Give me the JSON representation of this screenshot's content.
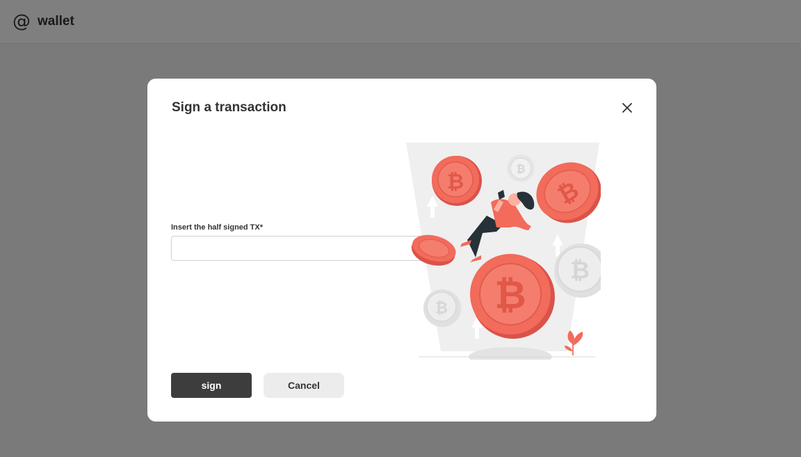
{
  "app": {
    "logo_symbol": "@",
    "logo_text": "wallet"
  },
  "modal": {
    "title": "Sign a transaction",
    "close_icon": "close-icon",
    "field": {
      "label": "Insert the half signed TX*",
      "value": "",
      "placeholder": ""
    },
    "buttons": {
      "sign_label": "sign",
      "cancel_label": "Cancel"
    },
    "illustration": "woman-floating-with-bitcoins-illustration"
  },
  "colors": {
    "overlay": "rgba(0,0,0,0.5)",
    "primary_button": "#3d3d3d",
    "secondary_button": "#ececec",
    "coin_accent": "#f26b5b",
    "coin_light": "#e9e9e9"
  }
}
